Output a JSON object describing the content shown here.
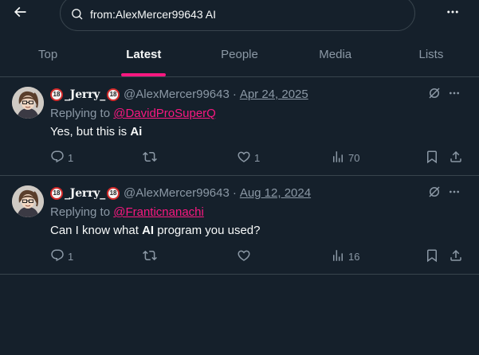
{
  "search": {
    "query": "from:AlexMercer99643 AI"
  },
  "tabs": [
    {
      "label": "Top",
      "active": false
    },
    {
      "label": "Latest",
      "active": true
    },
    {
      "label": "People",
      "active": false
    },
    {
      "label": "Media",
      "active": false
    },
    {
      "label": "Lists",
      "active": false
    }
  ],
  "posts": [
    {
      "display_name": "_Jerry_",
      "badge": "18",
      "handle": "@AlexMercer99643",
      "separator": "·",
      "date": "Apr 24, 2025",
      "replying_prefix": "Replying to ",
      "replying_to": "@DavidProSuperQ",
      "text_before": "Yes, but this is ",
      "text_bold": "Ai",
      "text_after": "",
      "replies": "1",
      "reposts": "",
      "likes": "1",
      "views": "70"
    },
    {
      "display_name": "_Jerry_",
      "badge": "18",
      "handle": "@AlexMercer99643",
      "separator": "·",
      "date": "Aug 12, 2024",
      "replying_prefix": "Replying to ",
      "replying_to": "@Franticnanachi",
      "text_before": "Can I know what ",
      "text_bold": "AI",
      "text_after": " program you used?",
      "replies": "1",
      "reposts": "",
      "likes": "",
      "views": "16"
    }
  ],
  "icons": {
    "back": "arrow-left-icon",
    "search": "search-icon",
    "more": "more-horizontal-icon",
    "grok": "grok-icon",
    "reply": "reply-icon",
    "repost": "repost-icon",
    "like": "heart-icon",
    "views": "views-icon",
    "bookmark": "bookmark-icon",
    "share": "share-icon"
  },
  "colors": {
    "background": "#15202b",
    "accent": "#f91880",
    "muted": "#8b98a5",
    "border": "#38444d",
    "text": "#f7f9f9"
  }
}
